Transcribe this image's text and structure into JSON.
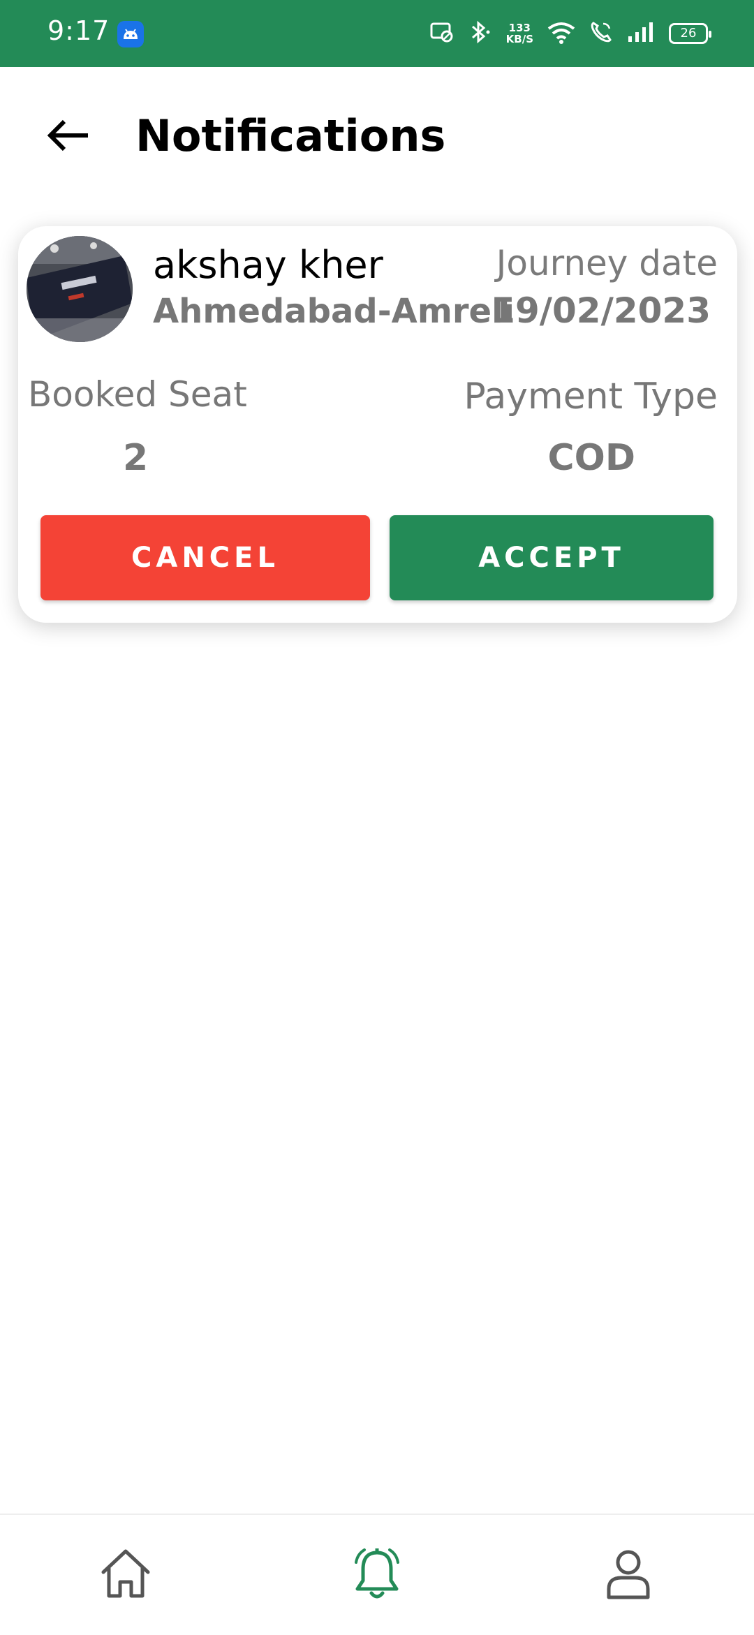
{
  "status_bar": {
    "time": "9:17",
    "net_speed_value": "133",
    "net_speed_unit": "KB/S",
    "battery": "26"
  },
  "header": {
    "title": "Notifications"
  },
  "notification": {
    "name": "akshay kher",
    "route": "Ahmedabad-Amreli",
    "journey_date_label": "Journey date",
    "journey_date": "19/02/2023",
    "booked_seat_label": "Booked Seat",
    "booked_seat": "2",
    "payment_type_label": "Payment Type",
    "payment_type": "COD",
    "cancel_label": "CANCEL",
    "accept_label": "ACCEPT"
  },
  "bottom_nav": {
    "items": [
      {
        "icon": "home-icon",
        "active": false
      },
      {
        "icon": "bell-icon",
        "active": true
      },
      {
        "icon": "user-icon",
        "active": false
      }
    ]
  },
  "colors": {
    "brand_green": "#238b57",
    "cancel_red": "#f44336",
    "muted_text": "#777777"
  }
}
